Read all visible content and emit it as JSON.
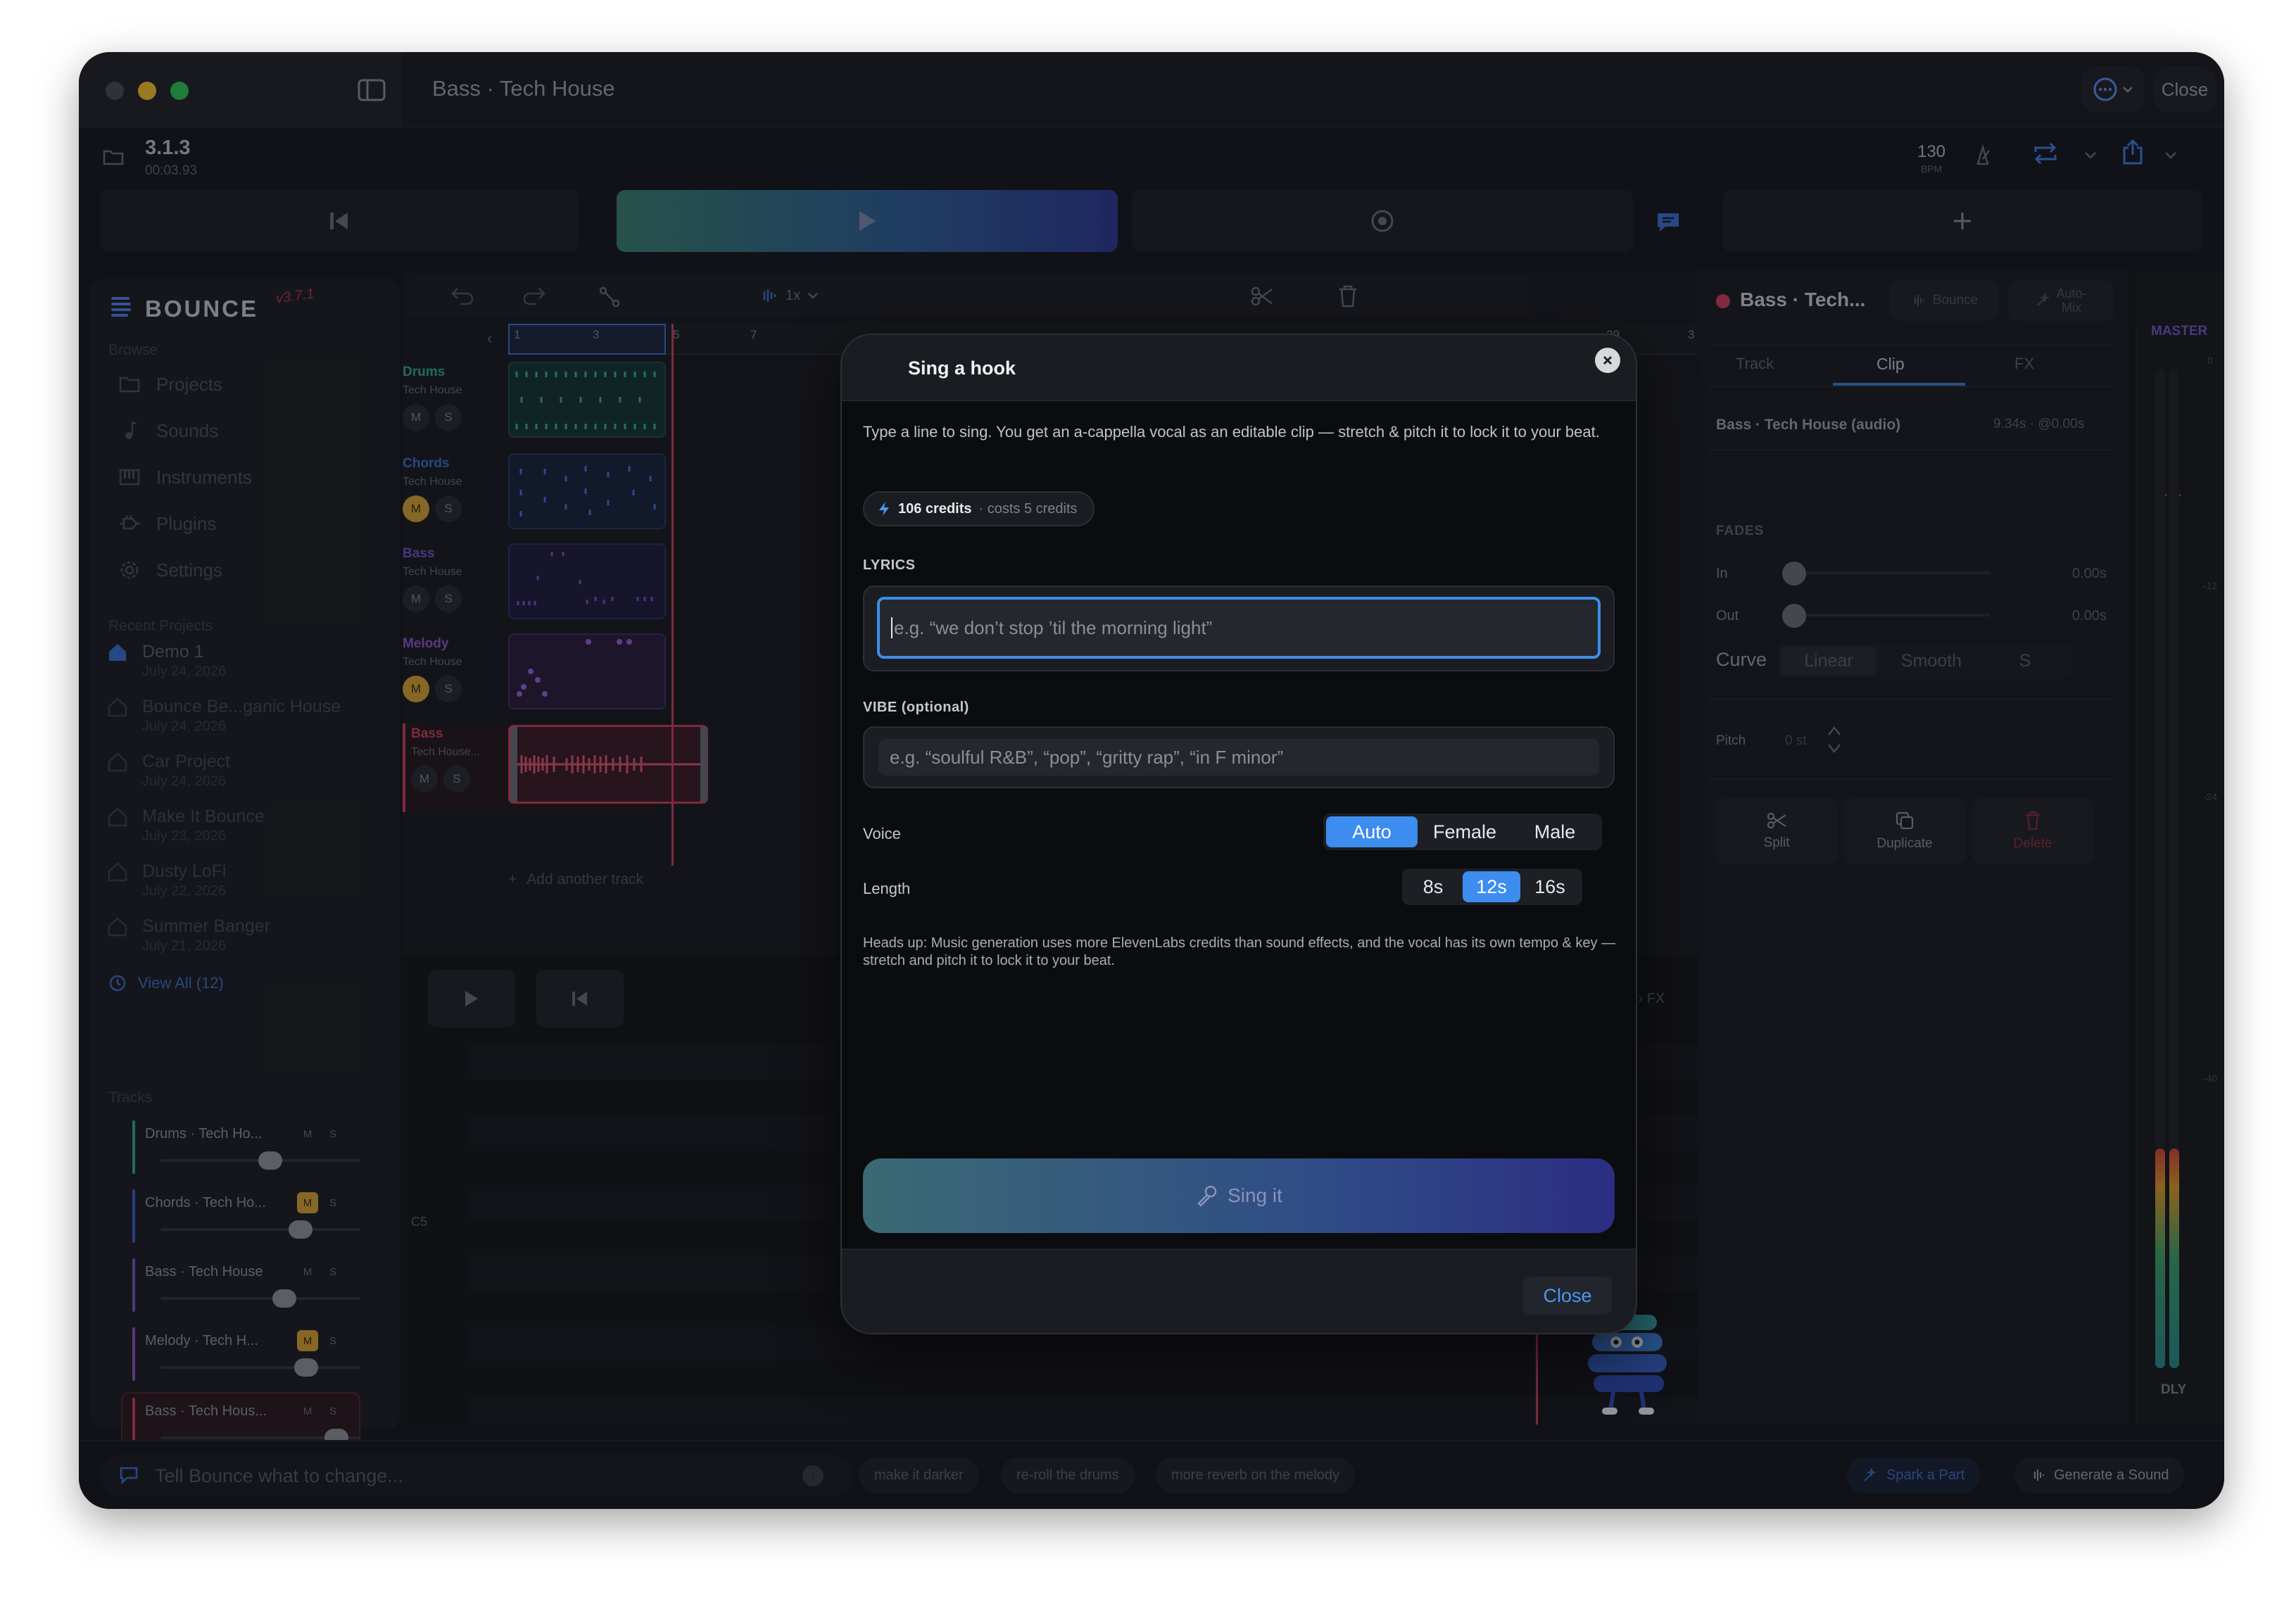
{
  "window": {
    "title": "Bass · Tech House",
    "close_label": "Close"
  },
  "header": {
    "version": "3.1.3",
    "timecode": "00:03.93",
    "bpm_value": "130",
    "bpm_label": "BPM"
  },
  "sidebar": {
    "logo": "BOUNCE",
    "logo_version": "v3.7.1",
    "browse_label": "Browse",
    "nav": [
      {
        "label": "Projects",
        "icon": "folder-icon"
      },
      {
        "label": "Sounds",
        "icon": "music-note-icon"
      },
      {
        "label": "Instruments",
        "icon": "piano-icon"
      },
      {
        "label": "Plugins",
        "icon": "plug-icon"
      },
      {
        "label": "Settings",
        "icon": "gear-icon"
      }
    ],
    "recent_label": "Recent Projects",
    "recent": [
      {
        "title": "Demo 1",
        "date": "July 24, 2026"
      },
      {
        "title": "Bounce Be...ganic House",
        "date": "July 24, 2026"
      },
      {
        "title": "Car Project",
        "date": "July 24, 2026"
      },
      {
        "title": "Make It Bounce",
        "date": "July 23, 2026"
      },
      {
        "title": "Dusty LoFi",
        "date": "July 22, 2026"
      },
      {
        "title": "Summer Banger",
        "date": "July 21, 2026"
      }
    ],
    "view_all": "View All (12)",
    "tracks_label": "Tracks",
    "tracks": [
      {
        "name": "Drums · Tech Ho...",
        "m": "M",
        "s": "S",
        "color": "#2fa98f",
        "level": 0.55,
        "muted": false
      },
      {
        "name": "Chords · Tech Ho...",
        "m": "M",
        "s": "S",
        "color": "#3d5fc9",
        "level": 0.7,
        "muted": true
      },
      {
        "name": "Bass · Tech House",
        "m": "M",
        "s": "S",
        "color": "#7a55c9",
        "level": 0.62,
        "muted": false
      },
      {
        "name": "Melody · Tech H...",
        "m": "M",
        "s": "S",
        "color": "#8a55c9",
        "level": 0.73,
        "muted": true
      },
      {
        "name": "Bass · Tech Hous...",
        "m": "M",
        "s": "S",
        "color": "#c9405e",
        "level": 0.88,
        "muted": false
      }
    ]
  },
  "toolbar": {
    "speed": "1x"
  },
  "arrangement": {
    "ruler": [
      "1",
      "3",
      "5",
      "7",
      "29",
      "3"
    ],
    "lanes": [
      {
        "name": "Drums",
        "sub": "Tech House",
        "color": "#2fa98f",
        "m": "M",
        "s": "S"
      },
      {
        "name": "Chords",
        "sub": "Tech House",
        "color": "#3d6fd0",
        "m": "M",
        "s": "S"
      },
      {
        "name": "Bass",
        "sub": "Tech House",
        "color": "#6f55c9",
        "m": "M",
        "s": "S"
      },
      {
        "name": "Melody",
        "sub": "Tech House",
        "color": "#9055c9",
        "m": "M",
        "s": "S"
      },
      {
        "name": "Bass",
        "sub": "Tech House...",
        "color": "#c9405e",
        "m": "M",
        "s": "S"
      }
    ],
    "add_track": "Add another track",
    "piano_note": "C5",
    "mix_hint": "d one in Mix › FX"
  },
  "inspector": {
    "title": "Bass · Tech...",
    "bounce_label": "Bounce",
    "automix_label": "Auto-\nMix",
    "tabs": [
      "Track",
      "Clip",
      "FX"
    ],
    "active_tab": "Clip",
    "clip_name": "Bass · Tech House (audio)",
    "clip_meta": "9.34s · @0.00s",
    "fades_label": "FADES",
    "fade_in_label": "In",
    "fade_in_value": "0.00s",
    "fade_out_label": "Out",
    "fade_out_value": "0.00s",
    "curve_label": "Curve",
    "curve_options": [
      "Linear",
      "Smooth",
      "S"
    ],
    "pitch_label": "Pitch",
    "pitch_value": "0 st",
    "actions": [
      {
        "label": "Split",
        "icon": "scissors-icon"
      },
      {
        "label": "Duplicate",
        "icon": "duplicate-icon"
      },
      {
        "label": "Delete",
        "icon": "trash-icon"
      }
    ]
  },
  "master": {
    "label": "MASTER",
    "ticks": [
      "0",
      "-12",
      "-24",
      "-40"
    ],
    "footer": "DLY",
    "level": 0.2
  },
  "promptbar": {
    "placeholder": "Tell Bounce what to change...",
    "chips": [
      "make it darker",
      "re-roll the drums",
      "more reverb on the melody"
    ],
    "spark": "Spark a Part",
    "generate": "Generate a Sound"
  },
  "dialog": {
    "title": "Sing a hook",
    "description": "Type a line to sing. You get an a-cappella vocal as an editable clip — stretch & pitch it to lock it to your beat.",
    "credits": "106 credits",
    "cost": "· costs 5 credits",
    "lyrics_label": "LYRICS",
    "lyrics_placeholder": "e.g. “we don’t stop ’til the morning light”",
    "vibe_label": "VIBE (optional)",
    "vibe_placeholder": "e.g. “soulful R&B”, “pop”, “gritty rap”, “in F minor”",
    "voice_label": "Voice",
    "voice_options": [
      "Auto",
      "Female",
      "Male"
    ],
    "voice_selected": "Auto",
    "length_label": "Length",
    "length_options": [
      "8s",
      "12s",
      "16s"
    ],
    "length_selected": "12s",
    "note": "Heads up: Music generation uses more ElevenLabs credits than sound effects, and the vocal has its own tempo & key — stretch and pitch it to lock it to your beat.",
    "sing_label": "Sing it",
    "close_label": "Close"
  },
  "colors": {
    "accent_blue": "#3d8cf0",
    "close_link": "#4b97f2",
    "playhead": "#c9405e"
  }
}
